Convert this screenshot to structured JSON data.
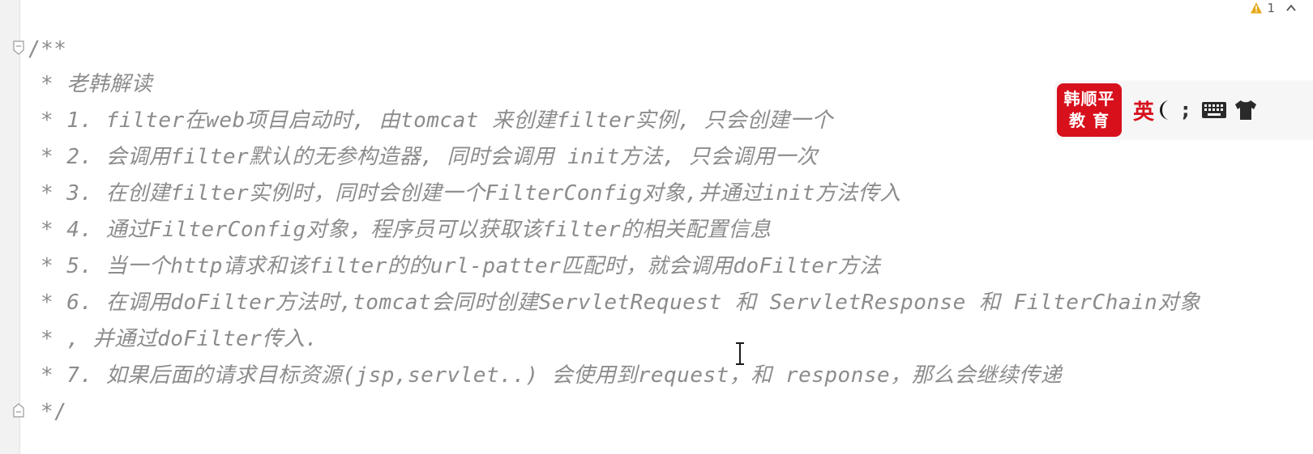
{
  "editor": {
    "lines": {
      "open": "/**",
      "l0": "* 老韩解读",
      "l1": "* 1. filter在web项目启动时, 由tomcat 来创建filter实例, 只会创建一个",
      "l2": "* 2. 会调用filter默认的无参构造器, 同时会调用 init方法, 只会调用一次",
      "l3": "* 3. 在创建filter实例时，同时会创建一个FilterConfig对象,并通过init方法传入",
      "l4": "* 4. 通过FilterConfig对象，程序员可以获取该filter的相关配置信息",
      "l5": "* 5. 当一个http请求和该filter的的url-patter匹配时，就会调用doFilter方法",
      "l6": "* 6. 在调用doFilter方法时,tomcat会同时创建ServletRequest 和 ServletResponse 和 FilterChain对象",
      "l7": "* , 并通过doFilter传入.",
      "l8": "* 7. 如果后面的请求目标资源(jsp,servlet..) 会使用到request，和 response，那么会继续传递",
      "close": "*/"
    }
  },
  "inspection": {
    "warning_count": "1",
    "warning_color": "#e6a817",
    "icons": [
      "warning-icon",
      "chevron-up-icon"
    ]
  },
  "ime_toolbar": {
    "logo_line1": "韩顺平",
    "logo_line2": "教 育",
    "lang": "英",
    "punct": ";",
    "brand_color": "#d7101c",
    "icons": [
      "moon-icon",
      "keyboard-icon",
      "skin-icon"
    ]
  }
}
